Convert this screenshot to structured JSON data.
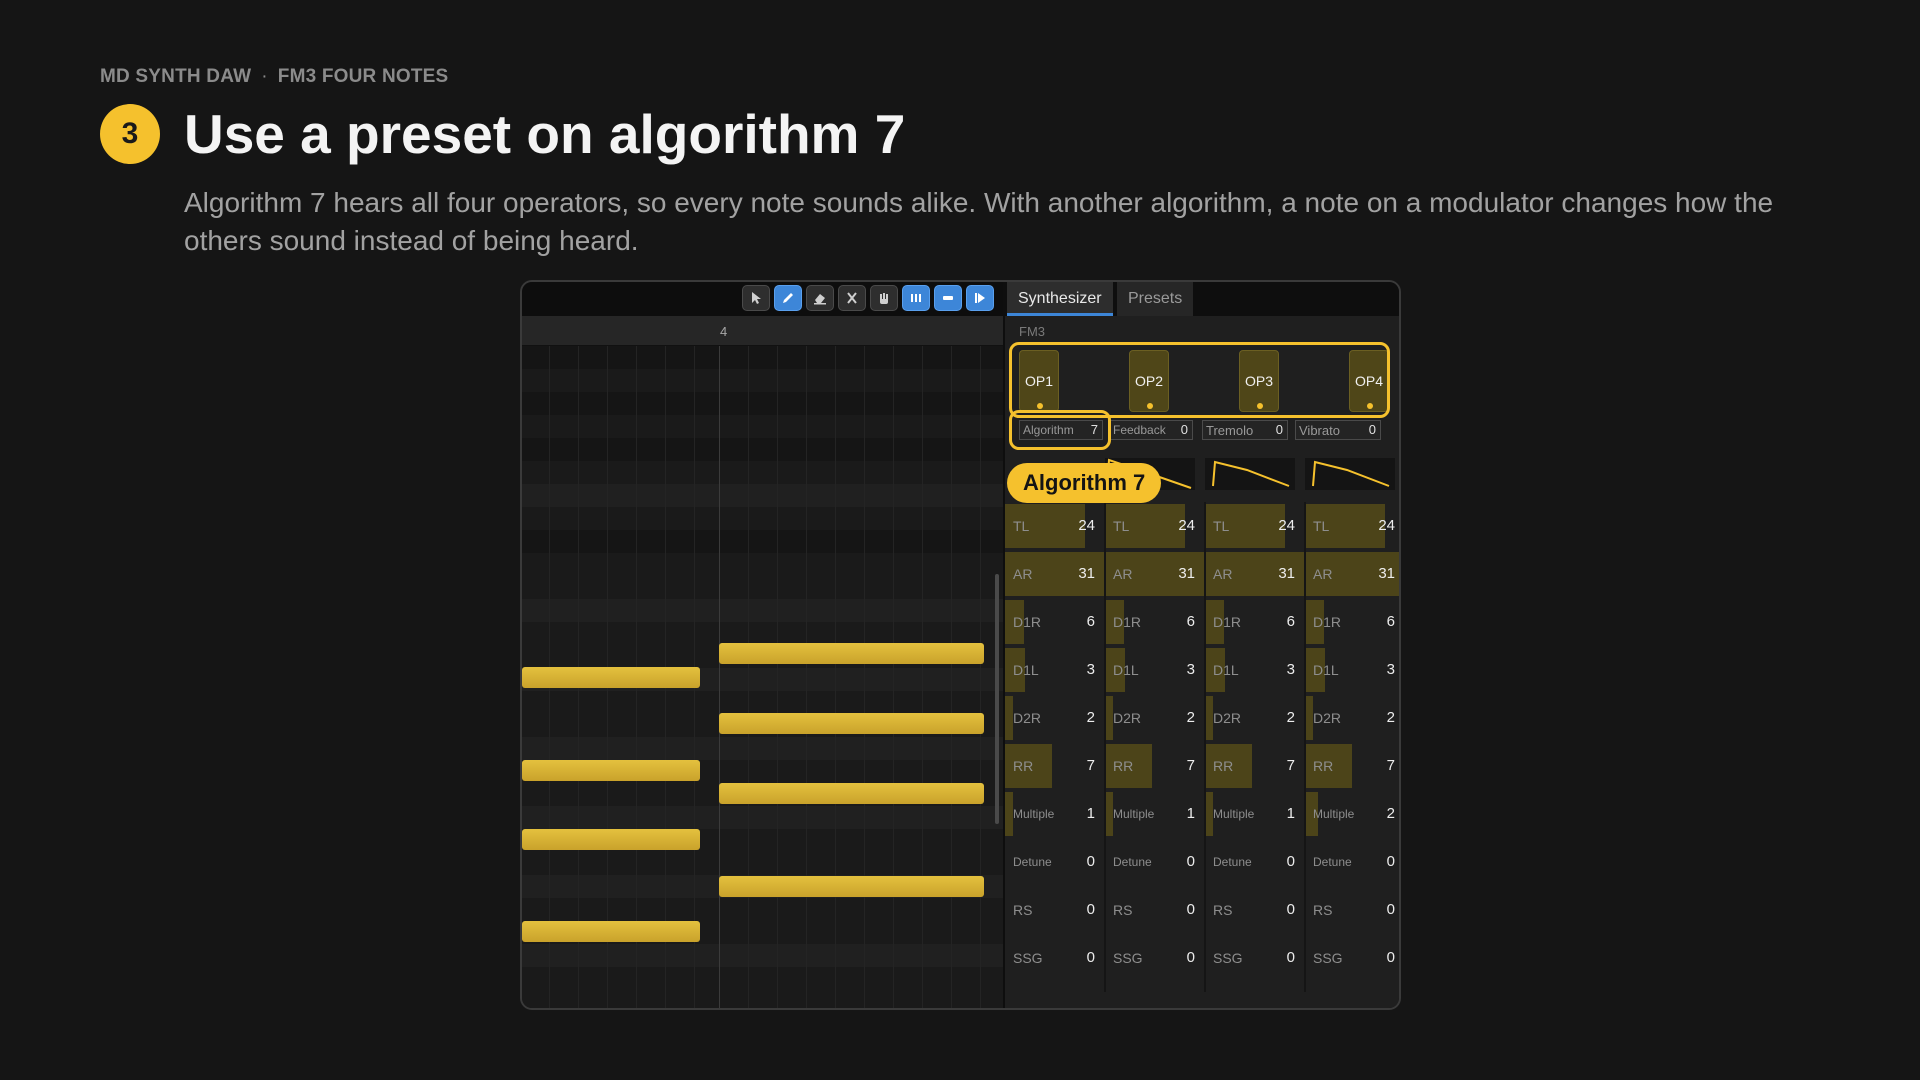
{
  "breadcrumb": {
    "app": "MD SYNTH DAW",
    "separator": "·",
    "section": "FM3 FOUR NOTES"
  },
  "step": {
    "number": "3",
    "title": "Use a preset on algorithm 7",
    "description": "Algorithm 7 hears all four operators, so every note sounds alike. With another algorithm, a note on a modulator changes how the others sound instead of being heard."
  },
  "toolbar": {
    "tools": [
      {
        "icon": "pointer-icon",
        "active": false
      },
      {
        "icon": "pencil-icon",
        "active": true
      },
      {
        "icon": "eraser-icon",
        "active": false
      },
      {
        "icon": "cut-icon",
        "active": false
      },
      {
        "icon": "hand-icon",
        "active": false
      },
      {
        "icon": "grid-snap-icon",
        "active": true
      },
      {
        "icon": "note-length-icon",
        "active": true
      },
      {
        "icon": "play-icon",
        "active": true
      }
    ]
  },
  "piano_roll": {
    "bar_number": "4"
  },
  "synth": {
    "tabs": [
      "Synthesizer",
      "Presets"
    ],
    "active_tab": "Synthesizer",
    "chip": "FM3",
    "operators": [
      "OP1",
      "OP2",
      "OP3",
      "OP4"
    ],
    "globals": [
      {
        "name": "Algorithm",
        "value": "7"
      },
      {
        "name": "Feedback",
        "value": "0"
      },
      {
        "name": "Tremolo",
        "value": "0"
      },
      {
        "name": "Vibrato",
        "value": "0"
      }
    ],
    "row_labels": [
      "TL",
      "AR",
      "D1R",
      "D1L",
      "D2R",
      "RR",
      "Multiple",
      "Detune",
      "RS",
      "SSG"
    ],
    "operator_values": [
      [
        "24",
        "31",
        "6",
        "3",
        "2",
        "7",
        "1",
        "0",
        "0",
        "0"
      ],
      [
        "24",
        "31",
        "6",
        "3",
        "2",
        "7",
        "1",
        "0",
        "0",
        "0"
      ],
      [
        "24",
        "31",
        "6",
        "3",
        "2",
        "7",
        "1",
        "0",
        "0",
        "0"
      ],
      [
        "24",
        "31",
        "6",
        "3",
        "2",
        "7",
        "2",
        "0",
        "0",
        "0"
      ]
    ]
  },
  "callout": {
    "label": "Algorithm 7"
  },
  "colors": {
    "accent": "#f5c12d",
    "note": "#d8b435",
    "tool_active": "#3d86d8"
  }
}
